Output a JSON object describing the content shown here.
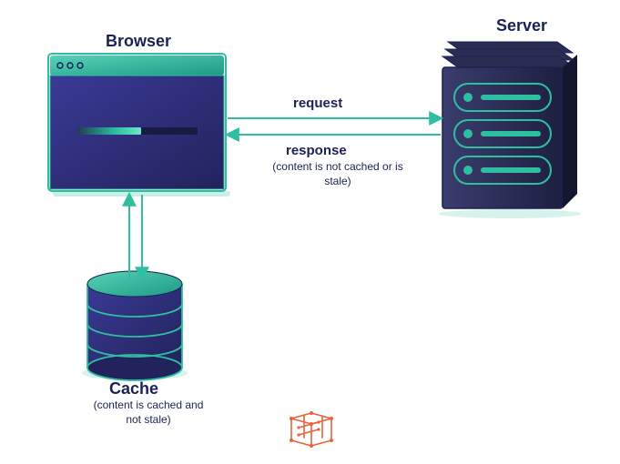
{
  "labels": {
    "browser": "Browser",
    "server": "Server",
    "cache": "Cache",
    "cache_sub": "(content is cached and not stale)",
    "request": "request",
    "response": "response",
    "response_sub": "(content is not cached or is stale)"
  },
  "colors": {
    "text": "#1a2255",
    "panel_fill": "#2d2e7a",
    "panel_stroke": "#1a2255",
    "teal": "#2fbfa0",
    "teal_light": "#55d3b7",
    "teal_dark": "#1f9984",
    "server_dark": "#2a2a4a",
    "logo": "#e8633a"
  }
}
